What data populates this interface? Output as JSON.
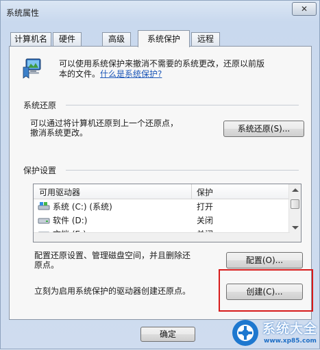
{
  "window": {
    "title": "系统属性",
    "close_glyph": "✕"
  },
  "tabs": [
    {
      "label": "计算机名"
    },
    {
      "label": "硬件"
    },
    {
      "label": "高级"
    },
    {
      "label": "系统保护"
    },
    {
      "label": "远程"
    }
  ],
  "active_tab": "系统保护",
  "intro": {
    "text_line1": "可以使用系统保护来撤消不需要的系统更改，还原以前版",
    "text_line2_prefix": "本的文件。",
    "link": "什么是系统保护?"
  },
  "restore_group": {
    "title": "系统还原",
    "desc_line1": "可以通过将计算机还原到上一个还原点，",
    "desc_line2": "撤消系统更改。",
    "button": "系统还原(S)..."
  },
  "protection_group": {
    "title": "保护设置",
    "columns": [
      "可用驱动器",
      "保护"
    ],
    "drives": [
      {
        "name": "系统 (C:) (系统)",
        "protection": "打开",
        "icon": "system-drive-icon"
      },
      {
        "name": "软件 (D:)",
        "protection": "关闭",
        "icon": "hard-drive-icon"
      },
      {
        "name": "文档 (E:)",
        "protection": "关闭",
        "icon": "hard-drive-icon"
      }
    ],
    "config_desc_line1": "配置还原设置、管理磁盘空间，并且删除还",
    "config_desc_line2": "原点。",
    "config_button": "配置(O)...",
    "create_desc": "立刻为启用系统保护的驱动器创建还原点。",
    "create_button": "创建(C)..."
  },
  "footer": {
    "ok_button": "确定"
  },
  "watermark": {
    "text": "系统大全",
    "url": "www.xp85.com"
  },
  "colors": {
    "highlight_box": "#d71a1a",
    "link": "#1c57b8",
    "window_frame": "#dbe6f4"
  }
}
